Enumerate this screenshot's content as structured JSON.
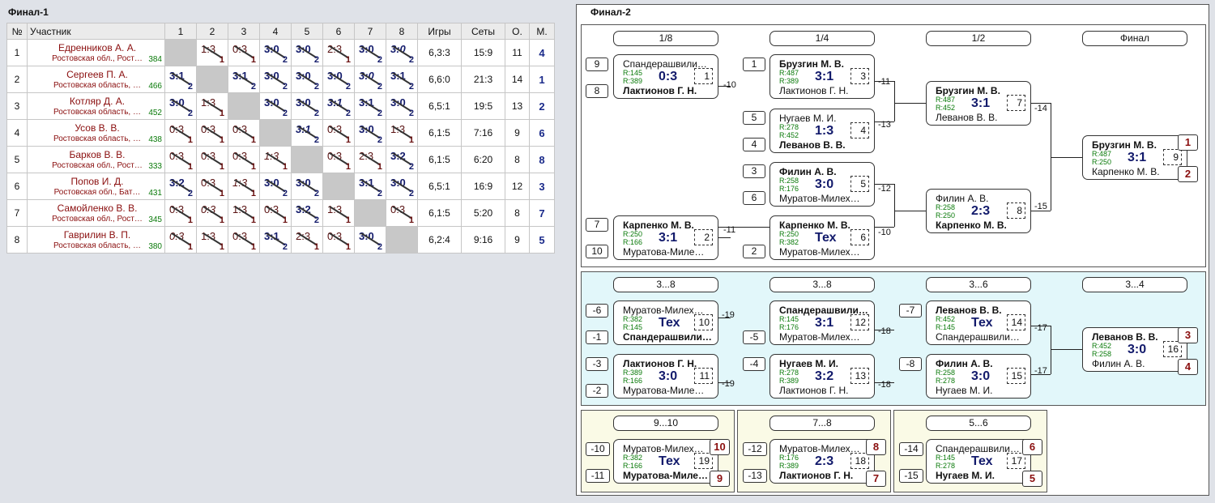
{
  "final1": {
    "title": "Финал-1",
    "headers": {
      "no": "№",
      "player": "Участник",
      "cols": [
        "1",
        "2",
        "3",
        "4",
        "5",
        "6",
        "7",
        "8"
      ],
      "games": "Игры",
      "sets": "Сеты",
      "points": "О.",
      "place": "М."
    },
    "rows": [
      {
        "no": "1",
        "name": "Едренников А. А.",
        "region": "Ростовская обл., Рост…",
        "rating": "384",
        "cells": [
          null,
          {
            "s": "1:3",
            "p": "1",
            "w": false,
            "i": false
          },
          {
            "s": "0:3",
            "p": "1",
            "w": false,
            "i": false
          },
          {
            "s": "3:0",
            "p": "2",
            "w": true,
            "i": false
          },
          {
            "s": "3:0",
            "p": "2",
            "w": true,
            "i": false
          },
          {
            "s": "2:3",
            "p": "1",
            "w": false,
            "i": false
          },
          {
            "s": "3:0",
            "p": "2",
            "w": true,
            "i": false
          },
          {
            "s": "3:0",
            "p": "2",
            "w": true,
            "i": true
          }
        ],
        "games": "6,3:3",
        "sets": "15:9",
        "points": "11",
        "place": "4"
      },
      {
        "no": "2",
        "name": "Сергеев П. А.",
        "region": "Ростовская область, …",
        "rating": "466",
        "cells": [
          {
            "s": "3:1",
            "p": "2",
            "w": true,
            "i": false
          },
          null,
          {
            "s": "3:1",
            "p": "2",
            "w": true,
            "i": false
          },
          {
            "s": "3:0",
            "p": "2",
            "w": true,
            "i": false
          },
          {
            "s": "3:0",
            "p": "2",
            "w": true,
            "i": false
          },
          {
            "s": "3:0",
            "p": "2",
            "w": true,
            "i": false
          },
          {
            "s": "3:0",
            "p": "2",
            "w": true,
            "i": true
          },
          {
            "s": "3:1",
            "p": "2",
            "w": true,
            "i": false
          }
        ],
        "games": "6,6:0",
        "sets": "21:3",
        "points": "14",
        "place": "1"
      },
      {
        "no": "3",
        "name": "Котляр Д. А.",
        "region": "Ростовская область, …",
        "rating": "452",
        "cells": [
          {
            "s": "3:0",
            "p": "2",
            "w": true,
            "i": false
          },
          {
            "s": "1:3",
            "p": "1",
            "w": false,
            "i": false
          },
          null,
          {
            "s": "3:0",
            "p": "2",
            "w": true,
            "i": false
          },
          {
            "s": "3:0",
            "p": "2",
            "w": true,
            "i": false
          },
          {
            "s": "3:1",
            "p": "2",
            "w": true,
            "i": true
          },
          {
            "s": "3:1",
            "p": "2",
            "w": true,
            "i": false
          },
          {
            "s": "3:0",
            "p": "2",
            "w": true,
            "i": false
          }
        ],
        "games": "6,5:1",
        "sets": "19:5",
        "points": "13",
        "place": "2"
      },
      {
        "no": "4",
        "name": "Усов В. В.",
        "region": "Ростовская область, …",
        "rating": "438",
        "cells": [
          {
            "s": "0:3",
            "p": "1",
            "w": false,
            "i": false
          },
          {
            "s": "0:3",
            "p": "1",
            "w": false,
            "i": false
          },
          {
            "s": "0:3",
            "p": "1",
            "w": false,
            "i": false
          },
          null,
          {
            "s": "3:1",
            "p": "2",
            "w": true,
            "i": true
          },
          {
            "s": "0:3",
            "p": "1",
            "w": false,
            "i": false
          },
          {
            "s": "3:0",
            "p": "2",
            "w": true,
            "i": false
          },
          {
            "s": "1:3",
            "p": "1",
            "w": false,
            "i": false
          }
        ],
        "games": "6,1:5",
        "sets": "7:16",
        "points": "9",
        "place": "6"
      },
      {
        "no": "5",
        "name": "Барков В. В.",
        "region": "Ростовская обл., Рост…",
        "rating": "333",
        "cells": [
          {
            "s": "0:3",
            "p": "1",
            "w": false,
            "i": false
          },
          {
            "s": "0:3",
            "p": "1",
            "w": false,
            "i": false
          },
          {
            "s": "0:3",
            "p": "1",
            "w": false,
            "i": false
          },
          {
            "s": "1:3",
            "p": "1",
            "w": false,
            "i": true
          },
          null,
          {
            "s": "0:3",
            "p": "1",
            "w": false,
            "i": false
          },
          {
            "s": "2:3",
            "p": "1",
            "w": false,
            "i": false
          },
          {
            "s": "3:2",
            "p": "2",
            "w": true,
            "i": false
          }
        ],
        "games": "6,1:5",
        "sets": "6:20",
        "points": "8",
        "place": "8"
      },
      {
        "no": "6",
        "name": "Попов И. Д.",
        "region": "Ростовская обл., Бат…",
        "rating": "431",
        "cells": [
          {
            "s": "3:2",
            "p": "2",
            "w": true,
            "i": false
          },
          {
            "s": "0:3",
            "p": "1",
            "w": false,
            "i": false
          },
          {
            "s": "1:3",
            "p": "1",
            "w": false,
            "i": true
          },
          {
            "s": "3:0",
            "p": "2",
            "w": true,
            "i": false
          },
          {
            "s": "3:0",
            "p": "2",
            "w": true,
            "i": false
          },
          null,
          {
            "s": "3:1",
            "p": "2",
            "w": true,
            "i": false
          },
          {
            "s": "3:0",
            "p": "2",
            "w": true,
            "i": false
          }
        ],
        "games": "6,5:1",
        "sets": "16:9",
        "points": "12",
        "place": "3"
      },
      {
        "no": "7",
        "name": "Самойленко В. В.",
        "region": "Ростовская обл., Рост…",
        "rating": "345",
        "cells": [
          {
            "s": "0:3",
            "p": "1",
            "w": false,
            "i": false
          },
          {
            "s": "0:3",
            "p": "1",
            "w": false,
            "i": true
          },
          {
            "s": "1:3",
            "p": "1",
            "w": false,
            "i": false
          },
          {
            "s": "0:3",
            "p": "1",
            "w": false,
            "i": false
          },
          {
            "s": "3:2",
            "p": "2",
            "w": true,
            "i": false
          },
          {
            "s": "1:3",
            "p": "1",
            "w": false,
            "i": false
          },
          null,
          {
            "s": "0:3",
            "p": "1",
            "w": false,
            "i": false
          }
        ],
        "games": "6,1:5",
        "sets": "5:20",
        "points": "8",
        "place": "7"
      },
      {
        "no": "8",
        "name": "Гаврилин В. П.",
        "region": "Ростовская область, …",
        "rating": "380",
        "cells": [
          {
            "s": "0:3",
            "p": "1",
            "w": false,
            "i": true
          },
          {
            "s": "1:3",
            "p": "1",
            "w": false,
            "i": false
          },
          {
            "s": "0:3",
            "p": "1",
            "w": false,
            "i": false
          },
          {
            "s": "3:1",
            "p": "2",
            "w": true,
            "i": false
          },
          {
            "s": "2:3",
            "p": "1",
            "w": false,
            "i": false
          },
          {
            "s": "0:3",
            "p": "1",
            "w": false,
            "i": false
          },
          {
            "s": "3:0",
            "p": "2",
            "w": true,
            "i": false
          },
          null
        ],
        "games": "6,2:4",
        "sets": "9:16",
        "points": "9",
        "place": "5"
      }
    ]
  },
  "final2": {
    "title": "Финал-2",
    "rounds": [
      {
        "id": "r18",
        "label": "1/8"
      },
      {
        "id": "r14",
        "label": "1/4"
      },
      {
        "id": "r12",
        "label": "1/2"
      },
      {
        "id": "rf",
        "label": "Финал"
      },
      {
        "id": "c38a",
        "label": "3...8"
      },
      {
        "id": "c38b",
        "label": "3...8"
      },
      {
        "id": "c36",
        "label": "3...6"
      },
      {
        "id": "c34",
        "label": "3...4"
      },
      {
        "id": "c910",
        "label": "9...10"
      },
      {
        "id": "c78",
        "label": "7...8"
      },
      {
        "id": "c56",
        "label": "5...6"
      }
    ],
    "seeds": [
      {
        "id": "s1",
        "t": "9"
      },
      {
        "id": "s2",
        "t": "8"
      },
      {
        "id": "s3",
        "t": "7"
      },
      {
        "id": "s4",
        "t": "10"
      },
      {
        "id": "s5",
        "t": "1"
      },
      {
        "id": "s6",
        "t": "5"
      },
      {
        "id": "s7",
        "t": "4"
      },
      {
        "id": "s8",
        "t": "3"
      },
      {
        "id": "s9",
        "t": "6"
      },
      {
        "id": "s10",
        "t": "2"
      },
      {
        "id": "s11",
        "t": "-6"
      },
      {
        "id": "s12",
        "t": "-1"
      },
      {
        "id": "s13",
        "t": "-3"
      },
      {
        "id": "s14",
        "t": "-2"
      },
      {
        "id": "s15",
        "t": "-5"
      },
      {
        "id": "s16",
        "t": "-4"
      },
      {
        "id": "s17",
        "t": "-7"
      },
      {
        "id": "s18",
        "t": "-8"
      },
      {
        "id": "s19",
        "t": "-10"
      },
      {
        "id": "s20",
        "t": "-11"
      },
      {
        "id": "s21",
        "t": "-12"
      },
      {
        "id": "s22",
        "t": "-13"
      },
      {
        "id": "s23",
        "t": "-14"
      },
      {
        "id": "s24",
        "t": "-15"
      }
    ],
    "matches": [
      {
        "id": "m1",
        "p1": "Спандерашвили…",
        "p2": "Лактионов Г. Н.",
        "b": 2,
        "r1": "R:145",
        "r2": "R:389",
        "score": "0:3",
        "num": "1"
      },
      {
        "id": "m2",
        "p1": "Карпенко М. В.",
        "p2": "Муратова-Миле…",
        "b": 1,
        "r1": "R:250",
        "r2": "R:166",
        "score": "3:1",
        "num": "2"
      },
      {
        "id": "m3",
        "p1": "Брузгин М. В.",
        "p2": "Лактионов Г. Н.",
        "b": 1,
        "r1": "R:487",
        "r2": "R:389",
        "score": "3:1",
        "num": "3"
      },
      {
        "id": "m4",
        "p1": "Нугаев М. И.",
        "p2": "Леванов В. В.",
        "b": 2,
        "r1": "R:278",
        "r2": "R:452",
        "score": "1:3",
        "num": "4"
      },
      {
        "id": "m5",
        "p1": "Филин А. В.",
        "p2": "Муратов-Милех…",
        "b": 1,
        "r1": "R:258",
        "r2": "R:176",
        "score": "3:0",
        "num": "5"
      },
      {
        "id": "m6",
        "p1": "Карпенко М. В.",
        "p2": "Муратов-Милех…",
        "b": 1,
        "r1": "R:250",
        "r2": "R:382",
        "score": "Тех",
        "num": "6"
      },
      {
        "id": "m7",
        "p1": "Брузгин М. В.",
        "p2": "Леванов В. В.",
        "b": 1,
        "r1": "R:487",
        "r2": "R:452",
        "score": "3:1",
        "num": "7"
      },
      {
        "id": "m8",
        "p1": "Филин А. В.",
        "p2": "Карпенко М. В.",
        "b": 2,
        "r1": "R:258",
        "r2": "R:250",
        "score": "2:3",
        "num": "8"
      },
      {
        "id": "m9",
        "p1": "Брузгин М. В.",
        "p2": "Карпенко М. В.",
        "b": 1,
        "r1": "R:487",
        "r2": "R:250",
        "score": "3:1",
        "num": "9"
      },
      {
        "id": "m10",
        "p1": "Муратов-Милех…",
        "p2": "Спандерашвили…",
        "b": 2,
        "r1": "R:382",
        "r2": "R:145",
        "score": "Тех",
        "num": "10"
      },
      {
        "id": "m11",
        "p1": "Лактионов Г. Н.",
        "p2": "Муратова-Миле…",
        "b": 1,
        "r1": "R:389",
        "r2": "R:166",
        "score": "3:0",
        "num": "11"
      },
      {
        "id": "m12",
        "p1": "Спандерашвили…",
        "p2": "Муратов-Милех…",
        "b": 1,
        "r1": "R:145",
        "r2": "R:176",
        "score": "3:1",
        "num": "12"
      },
      {
        "id": "m13",
        "p1": "Нугаев М. И.",
        "p2": "Лактионов Г. Н.",
        "b": 1,
        "r1": "R:278",
        "r2": "R:389",
        "score": "3:2",
        "num": "13"
      },
      {
        "id": "m14",
        "p1": "Леванов В. В.",
        "p2": "Спандерашвили…",
        "b": 1,
        "r1": "R:452",
        "r2": "R:145",
        "score": "Тех",
        "num": "14"
      },
      {
        "id": "m15",
        "p1": "Филин А. В.",
        "p2": "Нугаев М. И.",
        "b": 1,
        "r1": "R:258",
        "r2": "R:278",
        "score": "3:0",
        "num": "15"
      },
      {
        "id": "m16",
        "p1": "Леванов В. В.",
        "p2": "Филин А. В.",
        "b": 1,
        "r1": "R:452",
        "r2": "R:258",
        "score": "3:0",
        "num": "16"
      },
      {
        "id": "m17",
        "p1": "Спандерашвили…",
        "p2": "Нугаев М. И.",
        "b": 2,
        "r1": "R:145",
        "r2": "R:278",
        "score": "Тех",
        "num": "17"
      },
      {
        "id": "m18",
        "p1": "Муратов-Милех…",
        "p2": "Лактионов Г. Н.",
        "b": 2,
        "r1": "R:176",
        "r2": "R:389",
        "score": "2:3",
        "num": "18"
      },
      {
        "id": "m19",
        "p1": "Муратов-Милех…",
        "p2": "Муратова-Миле…",
        "b": 2,
        "r1": "R:382",
        "r2": "R:166",
        "score": "Тех",
        "num": "19"
      }
    ],
    "places": [
      {
        "id": "pl1",
        "t": "1"
      },
      {
        "id": "pl2",
        "t": "2"
      },
      {
        "id": "pl3",
        "t": "3"
      },
      {
        "id": "pl4",
        "t": "4"
      },
      {
        "id": "pl5",
        "t": "10"
      },
      {
        "id": "pl6",
        "t": "9"
      },
      {
        "id": "pl7",
        "t": "8"
      },
      {
        "id": "pl8",
        "t": "7"
      },
      {
        "id": "pl9",
        "t": "6"
      },
      {
        "id": "pl10",
        "t": "5"
      }
    ],
    "links": [
      {
        "id": "l1",
        "t": "-10"
      },
      {
        "id": "l2",
        "t": "-11"
      },
      {
        "id": "l3",
        "t": "-11"
      },
      {
        "id": "l4",
        "t": "-13"
      },
      {
        "id": "l5",
        "t": "-12"
      },
      {
        "id": "l6",
        "t": "-10"
      },
      {
        "id": "l7",
        "t": "-14"
      },
      {
        "id": "l8",
        "t": "-15"
      },
      {
        "id": "l9",
        "t": "-19"
      },
      {
        "id": "l10",
        "t": "-19"
      },
      {
        "id": "l11",
        "t": "-18"
      },
      {
        "id": "l12",
        "t": "-18"
      },
      {
        "id": "l13",
        "t": "-17"
      },
      {
        "id": "l14",
        "t": "-17"
      }
    ]
  },
  "colors": {
    "winner_score": "#121a6b",
    "loser_score": "#5a1212",
    "rating": "#0a7a0a",
    "place_badge": "#8a0e0e",
    "consolation_bg": "#e2f7fa",
    "placement_bg": "#fafae6"
  }
}
